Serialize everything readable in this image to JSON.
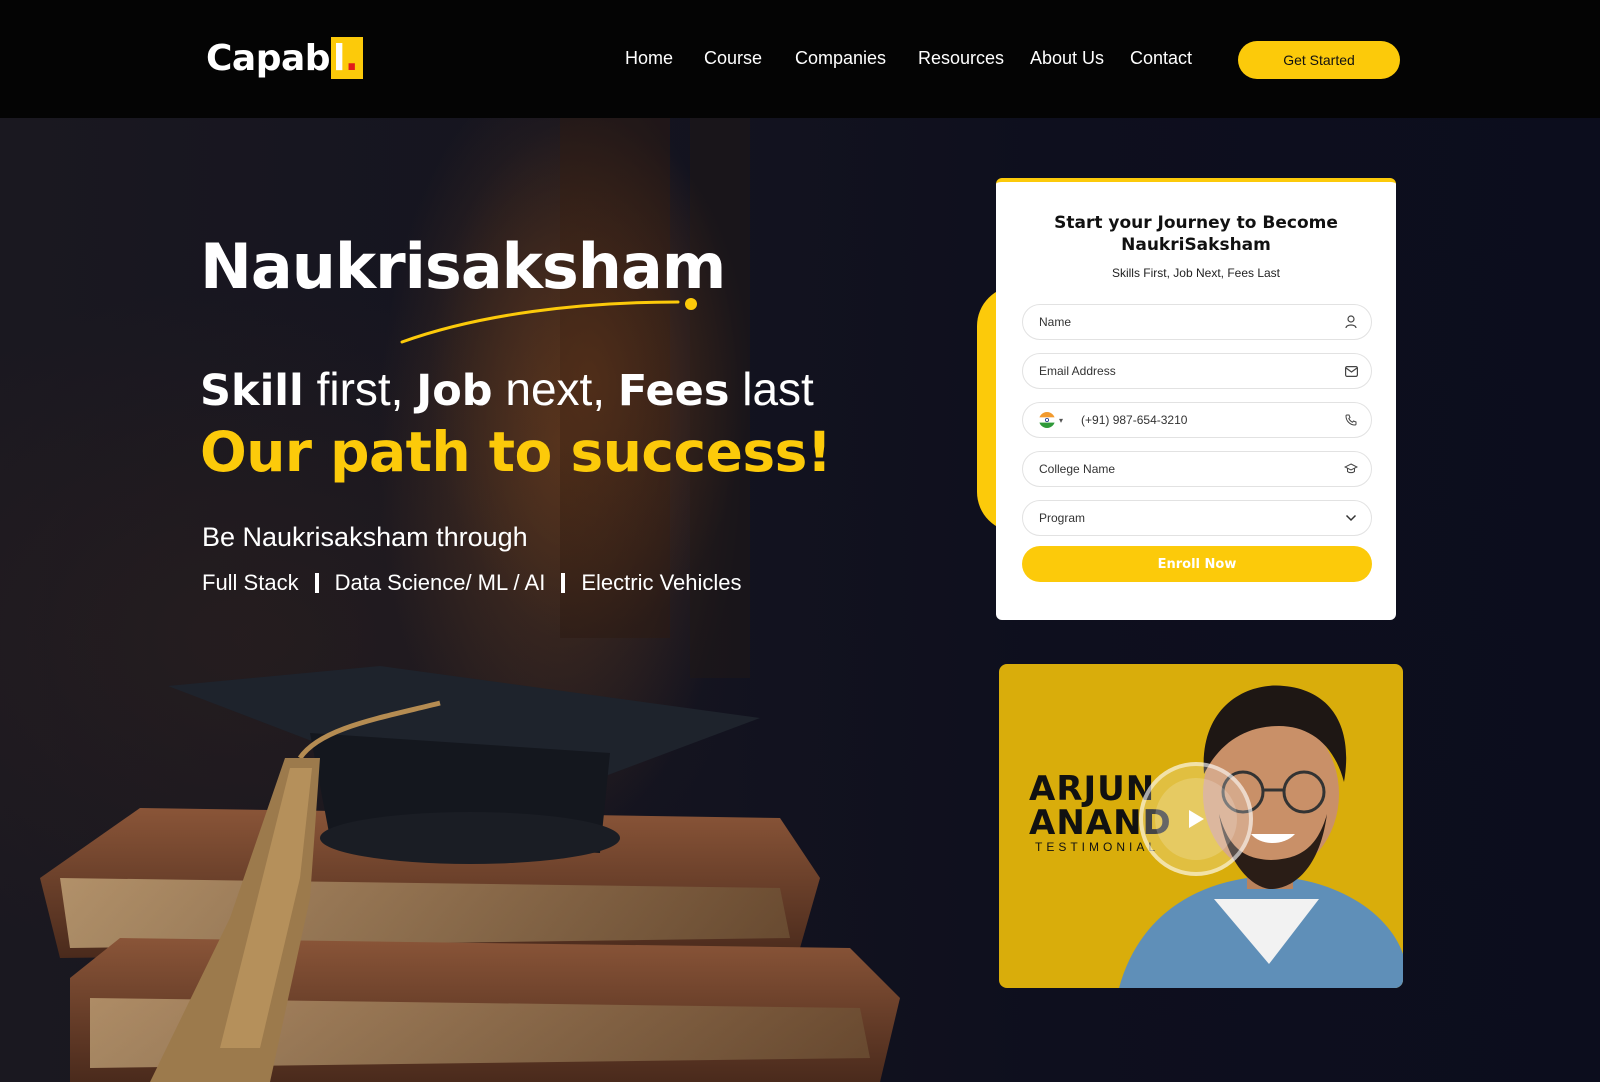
{
  "brand": {
    "logo_white": "Capab",
    "logo_box": "l",
    "logo_dot": "."
  },
  "nav": {
    "items": [
      "Home",
      "Course",
      "Companies",
      "Resources",
      "About Us",
      "Contact"
    ],
    "cta": "Get Started"
  },
  "hero": {
    "heading": "Naukrisaksham",
    "tagline": {
      "w1": "Skill",
      "w2": " first, ",
      "w3": "Job",
      "w4": " next, ",
      "w5": "Fees",
      "w6": " last"
    },
    "highlight": "Our path to success!",
    "through": "Be Naukrisaksham through",
    "programs": [
      "Full Stack",
      "Data Science/ ML / AI",
      "Electric Vehicles"
    ]
  },
  "form": {
    "title_line1": "Start your Journey to Become",
    "title_line2": "NaukriSaksham",
    "subtitle": "Skills First, Job Next, Fees Last",
    "name_placeholder": "Name",
    "email_placeholder": "Email Address",
    "phone_placeholder": "(+91) 987-654-3210",
    "college_placeholder": "College Name",
    "program_selected": "Program",
    "submit": "Enroll Now"
  },
  "testimonial": {
    "first_name": "ARJUN",
    "last_name": "ANAND",
    "label": "TESTIMONIAL"
  },
  "colors": {
    "accent": "#fcca0a",
    "nav_bg": "#040404",
    "video_bg": "#d9ad0b"
  },
  "icons": [
    "user-icon",
    "mail-icon",
    "phone-icon",
    "graduation-icon",
    "chevron-down-icon",
    "play-icon",
    "india-flag-icon"
  ]
}
